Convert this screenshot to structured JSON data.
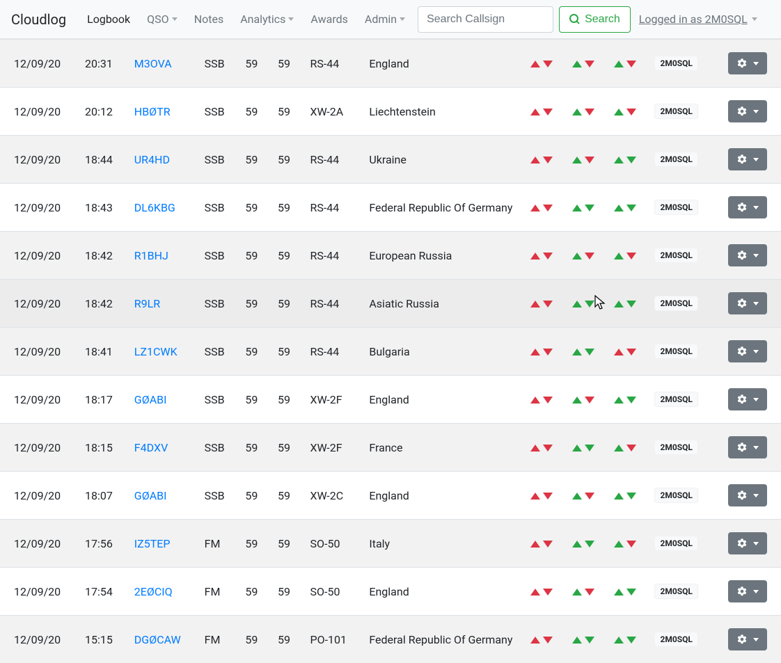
{
  "brand": "Cloudlog",
  "nav": {
    "logbook": "Logbook",
    "qso": "QSO",
    "notes": "Notes",
    "analytics": "Analytics",
    "awards": "Awards",
    "admin": "Admin"
  },
  "search": {
    "placeholder": "Search Callsign",
    "button": "Search"
  },
  "logged_in_text": "Logged in as 2M0SQL",
  "station_badge": "2M0SQL",
  "rows": [
    {
      "date": "12/09/20",
      "time": "20:31",
      "call": "M3OVA",
      "mode": "SSB",
      "rst_s": "59",
      "rst_r": "59",
      "band": "RS-44",
      "country": "England",
      "t1": [
        "red",
        "red"
      ],
      "t2": [
        "green",
        "red"
      ],
      "t3": [
        "green",
        "red"
      ]
    },
    {
      "date": "12/09/20",
      "time": "20:12",
      "call": "HBØTR",
      "mode": "SSB",
      "rst_s": "59",
      "rst_r": "59",
      "band": "XW-2A",
      "country": "Liechtenstein",
      "t1": [
        "red",
        "red"
      ],
      "t2": [
        "green",
        "red"
      ],
      "t3": [
        "green",
        "red"
      ]
    },
    {
      "date": "12/09/20",
      "time": "18:44",
      "call": "UR4HD",
      "mode": "SSB",
      "rst_s": "59",
      "rst_r": "59",
      "band": "RS-44",
      "country": "Ukraine",
      "t1": [
        "red",
        "red"
      ],
      "t2": [
        "green",
        "red"
      ],
      "t3": [
        "green",
        "green"
      ]
    },
    {
      "date": "12/09/20",
      "time": "18:43",
      "call": "DL6KBG",
      "mode": "SSB",
      "rst_s": "59",
      "rst_r": "59",
      "band": "RS-44",
      "country": "Federal Republic Of Germany",
      "t1": [
        "red",
        "red"
      ],
      "t2": [
        "green",
        "green"
      ],
      "t3": [
        "green",
        "green"
      ]
    },
    {
      "date": "12/09/20",
      "time": "18:42",
      "call": "R1BHJ",
      "mode": "SSB",
      "rst_s": "59",
      "rst_r": "59",
      "band": "RS-44",
      "country": "European Russia",
      "t1": [
        "red",
        "red"
      ],
      "t2": [
        "green",
        "red"
      ],
      "t3": [
        "green",
        "red"
      ]
    },
    {
      "date": "12/09/20",
      "time": "18:42",
      "call": "R9LR",
      "mode": "SSB",
      "rst_s": "59",
      "rst_r": "59",
      "band": "RS-44",
      "country": "Asiatic Russia",
      "t1": [
        "red",
        "red"
      ],
      "t2": [
        "green",
        "green"
      ],
      "t3": [
        "green",
        "green"
      ],
      "hover": true
    },
    {
      "date": "12/09/20",
      "time": "18:41",
      "call": "LZ1CWK",
      "mode": "SSB",
      "rst_s": "59",
      "rst_r": "59",
      "band": "RS-44",
      "country": "Bulgaria",
      "t1": [
        "red",
        "red"
      ],
      "t2": [
        "green",
        "green"
      ],
      "t3": [
        "red",
        "red"
      ]
    },
    {
      "date": "12/09/20",
      "time": "18:17",
      "call": "GØABI",
      "mode": "SSB",
      "rst_s": "59",
      "rst_r": "59",
      "band": "XW-2F",
      "country": "England",
      "t1": [
        "red",
        "red"
      ],
      "t2": [
        "green",
        "red"
      ],
      "t3": [
        "green",
        "green"
      ]
    },
    {
      "date": "12/09/20",
      "time": "18:15",
      "call": "F4DXV",
      "mode": "SSB",
      "rst_s": "59",
      "rst_r": "59",
      "band": "XW-2F",
      "country": "France",
      "t1": [
        "red",
        "red"
      ],
      "t2": [
        "green",
        "green"
      ],
      "t3": [
        "green",
        "red"
      ]
    },
    {
      "date": "12/09/20",
      "time": "18:07",
      "call": "GØABI",
      "mode": "SSB",
      "rst_s": "59",
      "rst_r": "59",
      "band": "XW-2C",
      "country": "England",
      "t1": [
        "red",
        "red"
      ],
      "t2": [
        "green",
        "red"
      ],
      "t3": [
        "green",
        "green"
      ]
    },
    {
      "date": "12/09/20",
      "time": "17:56",
      "call": "IZ5TEP",
      "mode": "FM",
      "rst_s": "59",
      "rst_r": "59",
      "band": "SO-50",
      "country": "Italy",
      "t1": [
        "red",
        "red"
      ],
      "t2": [
        "green",
        "green"
      ],
      "t3": [
        "green",
        "red"
      ]
    },
    {
      "date": "12/09/20",
      "time": "17:54",
      "call": "2EØCIQ",
      "mode": "FM",
      "rst_s": "59",
      "rst_r": "59",
      "band": "SO-50",
      "country": "England",
      "t1": [
        "red",
        "red"
      ],
      "t2": [
        "green",
        "red"
      ],
      "t3": [
        "green",
        "green"
      ]
    },
    {
      "date": "12/09/20",
      "time": "15:15",
      "call": "DGØCAW",
      "mode": "FM",
      "rst_s": "59",
      "rst_r": "59",
      "band": "PO-101",
      "country": "Federal Republic Of Germany",
      "t1": [
        "red",
        "red"
      ],
      "t2": [
        "green",
        "green"
      ],
      "t3": [
        "green",
        "green"
      ]
    }
  ]
}
